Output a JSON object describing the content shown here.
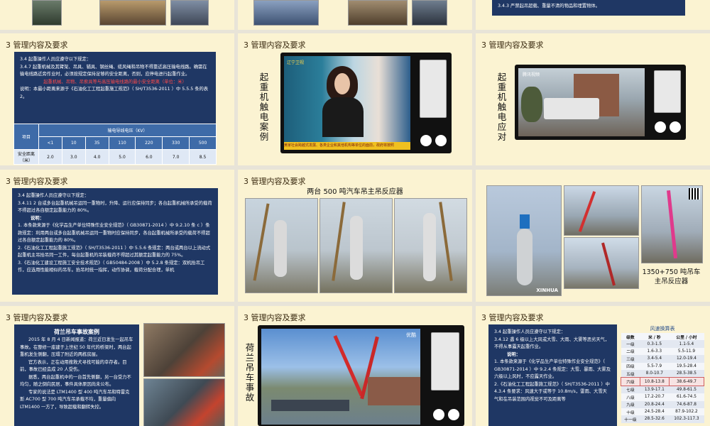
{
  "colors": {
    "slide_bg": "#fbf3d2",
    "panel": "#1f3764",
    "accent_red": "#ff4a4a"
  },
  "section_title": "3 管理内容及要求",
  "row0": {
    "right_text": "3.4.3 严禁起吊超载、重量不清的物品和埋置物体。"
  },
  "s1": {
    "lines": [
      "3.4 起重操作人员应遵守以下规定：",
      "3.4.7 起重机械及其臂架、吊具、辅具、钢丝绳、缆风绳和吊物不得靠近高压输电线路。确需在输电线路近旁作业时，必须按规定保持足够的安全距离，否则，应停电进行起重作业。",
      "起重机械、吊物、吊索具等与高压输电线路的最小安全距离（单位：米）",
      "说明：本最小距离来源于《石油化工工程起重施工规范》（ SH/T3536-2011 ）中 5.5.5 条的表 2。"
    ],
    "table": {
      "row_header": "项目",
      "col_header": "输电导线电压（KV）",
      "voltages": [
        "<1",
        "10",
        "35",
        "110",
        "220",
        "330",
        "500"
      ],
      "distance_label": "安全距离（米）",
      "distances": [
        "2.0",
        "3.0",
        "4.0",
        "5.0",
        "6.0",
        "7.0",
        "8.5"
      ]
    }
  },
  "s2": {
    "vertical": "起重机触电案例",
    "ticker": "黄家社会跨越式发展、各类企业和其他机构等单位的面前，政府将按照",
    "corner": "辽宁卫视"
  },
  "s3": {
    "vertical": "起重机触电应对",
    "corner": "腾讯视频"
  },
  "s4": {
    "lines": [
      "3.4 起重操作人员应遵守以下规定：",
      "3.4.11 2 台或多台起重机械吊运同一重物时，升降、运行应保持同步；各台起重机械所承受的载荷不得超过各自额定起重能力的 80%。",
      "说明：",
      "1. 本条款来源于《化学品生产单位特殊作业安全规范》（ GB30871-2014 ）中 9.2.10 条 c ）条款规定：利用两台或多台起重机械吊运同一重物时应保持同步，各台起重机械所承受的载荷不得超过各自额定起重能力的 80%。",
      "2.《石油化工工程起重施工规范》（ SH/T3536-2011 ）中 5.5.6 条规定：两台或两台以上流动式起重机主吊抬吊同一工件，每台起重机的吊装载荷不得超过其额定起重能力的 75%。",
      "3.《石油化工建设工程施工安全技术规范》（ GB50484-2008 ）中 5.2.8 条规定：双机抬吊工作，应选用性能相似的吊车。抬吊时统一指挥，动作协调，载荷分配合理，单机"
    ]
  },
  "s5": {
    "caption": "两台 500 吨汽车吊主吊反应器"
  },
  "s6": {
    "caption_line1": "1350+750 吨吊车",
    "caption_line2": "主吊反应器",
    "watermark": "XINHUA"
  },
  "s7": {
    "heading": "荷兰吊车事故案例",
    "paras": [
      "2015 年 8 月 4 日新闻报道：荷兰近日发生一起吊车事故。在整修一座建于上世纪 50 年代的桥梁时，两台起重机发生侧翻，压塌了附近的两栋房屋。",
      "官方表示，正在动用搜救犬寻找可能的幸存者。目前，事故已经造成 20 人受伤。",
      "据悉，两台起重机中的一台首先侧翻，另一台受力不均匀，随之倒向民居，事件具体原因尚未公布。",
      "专家的说法是 LTM1400 型 400 吨汽车吊和特雷克斯 AC700 型 700 吨汽车吊承载不均，重量偏向 LTM1400 一方了，导致超载和翻转失控。"
    ]
  },
  "s8": {
    "vertical": "荷兰吊车事故",
    "corner": "优酷"
  },
  "s9": {
    "lines": [
      "3.4 起重操作人员应遵守以下规定：",
      "3.4.12 遇 6 级以上大风或大雪、大雨、大雾等恶劣天气，不得从事露天起重作业。",
      "说明：",
      "1. 本条款来源于《化学品生产单位特殊作业安全规范》（ GB30871-2014 ）中 9.2.4 条规定：大雪、暴雨、大雾及六级以上风时，不应露天作业。",
      "2.《石油化工工程起重施工规范》（ SH/T3536-2011 ）中 4.3.4 条要求：风速大于或等于 10.8m/s，雷雨、大雪天气和在吊装范围内视觉不可及距离等"
    ],
    "wind": {
      "title": "风速换算表",
      "headers": [
        "级数",
        "米 / 秒",
        "公里 / 小时"
      ],
      "rows": [
        [
          "一级",
          "0.3-1.5",
          "1.1-5.4"
        ],
        [
          "二级",
          "1.6-3.3",
          "5.5-11.9"
        ],
        [
          "三级",
          "3.4-5.4",
          "12.0-19.4"
        ],
        [
          "四级",
          "5.5-7.9",
          "19.5-28.4"
        ],
        [
          "五级",
          "8.0-10.7",
          "28.5-38.5"
        ],
        [
          "六级",
          "10.8-13.8",
          "38.6-49.7"
        ],
        [
          "七级",
          "13.9-17.1",
          "49.8-61.5"
        ],
        [
          "八级",
          "17.2-20.7",
          "61.6-74.5"
        ],
        [
          "九级",
          "20.8-24.4",
          "74.6-87.8"
        ],
        [
          "十级",
          "24.5-28.4",
          "87.9-102.2"
        ],
        [
          "十一级",
          "28.5-32.6",
          "102.3-117.3"
        ]
      ]
    }
  }
}
